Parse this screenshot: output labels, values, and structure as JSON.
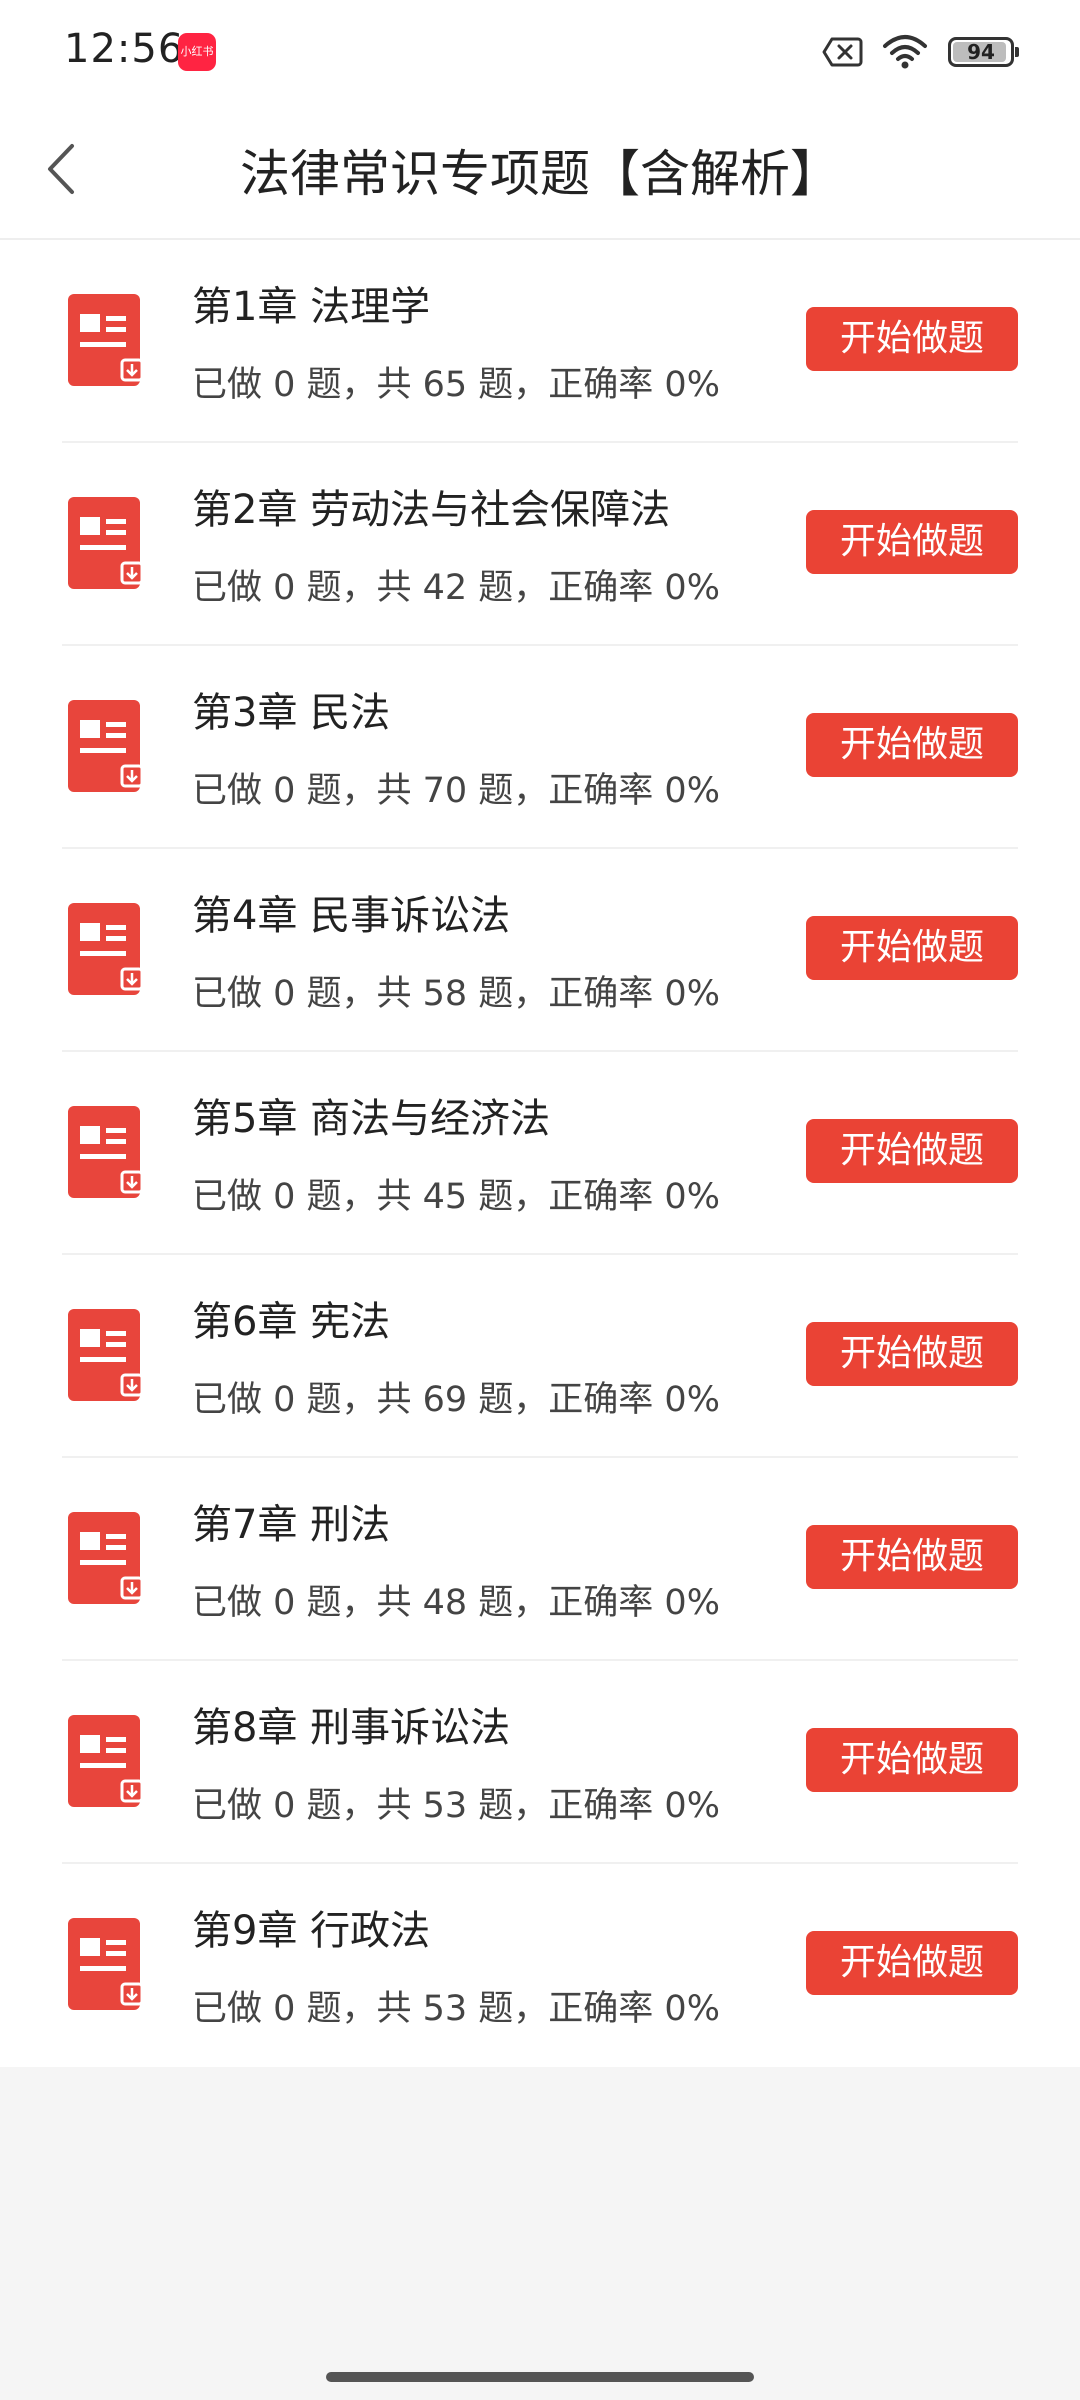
{
  "status_bar": {
    "time": "12:56",
    "app_badge": "小红书",
    "battery_percent": 94,
    "icons": [
      "notification-off-icon",
      "wifi-icon",
      "battery-icon"
    ]
  },
  "header": {
    "title": "法律常识专项题【含解析】",
    "back_icon": "chevron-left-icon"
  },
  "colors": {
    "accent": "#ea4335",
    "background": "#f5f5f5",
    "card": "#ffffff"
  },
  "chapters": [
    {
      "title": "第1章 法理学",
      "stats": "已做 0 题，共 65 题，正确率 0%",
      "button": "开始做题"
    },
    {
      "title": "第2章 劳动法与社会保障法",
      "stats": "已做 0 题，共 42 题，正确率 0%",
      "button": "开始做题"
    },
    {
      "title": "第3章 民法",
      "stats": "已做 0 题，共 70 题，正确率 0%",
      "button": "开始做题"
    },
    {
      "title": "第4章 民事诉讼法",
      "stats": "已做 0 题，共 58 题，正确率 0%",
      "button": "开始做题"
    },
    {
      "title": "第5章 商法与经济法",
      "stats": "已做 0 题，共 45 题，正确率 0%",
      "button": "开始做题"
    },
    {
      "title": "第6章 宪法",
      "stats": "已做 0 题，共 69 题，正确率 0%",
      "button": "开始做题"
    },
    {
      "title": "第7章 刑法",
      "stats": "已做 0 题，共 48 题，正确率 0%",
      "button": "开始做题"
    },
    {
      "title": "第8章 刑事诉讼法",
      "stats": "已做 0 题，共 53 题，正确率 0%",
      "button": "开始做题"
    },
    {
      "title": "第9章 行政法",
      "stats": "已做 0 题，共 53 题，正确率 0%",
      "button": "开始做题"
    }
  ]
}
